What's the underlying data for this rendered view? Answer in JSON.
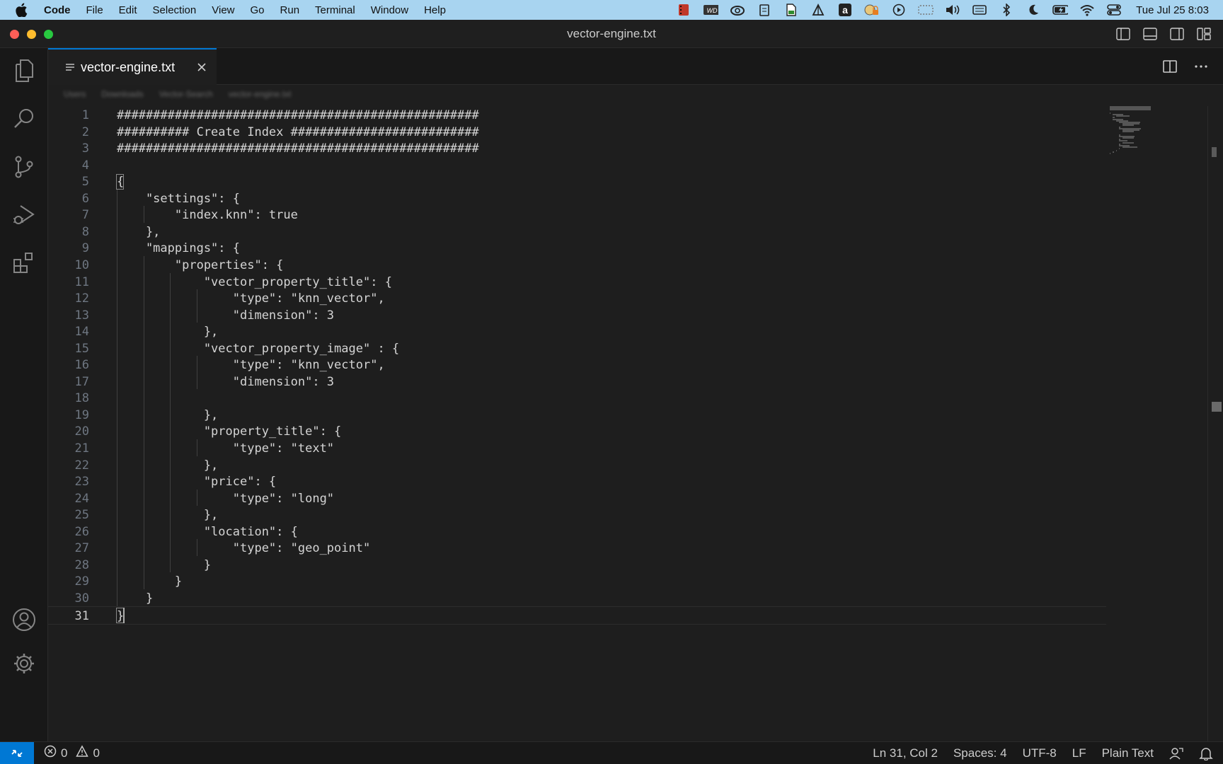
{
  "menubar": {
    "app_name": "Code",
    "items": [
      "File",
      "Edit",
      "Selection",
      "View",
      "Go",
      "Run",
      "Terminal",
      "Window",
      "Help"
    ],
    "status_icons": [
      "screen-recorder-icon",
      "wd-drive-icon",
      "creative-cloud-icon",
      "clipboard-icon",
      "file-icon",
      "vector-app-icon",
      "amazon-icon",
      "vpn-lock-icon",
      "play-icon",
      "display-icon",
      "volume-icon",
      "keyboard-icon",
      "bluetooth-icon",
      "moon-icon",
      "battery-icon",
      "wifi-icon",
      "control-center-icon"
    ],
    "clock": "Tue Jul 25  8:03"
  },
  "window": {
    "title": "vector-engine.txt"
  },
  "tab": {
    "label": "vector-engine.txt"
  },
  "breadcrumb": [
    "Users",
    "Downloads",
    "Vector-Search",
    "vector-engine.txt"
  ],
  "editor": {
    "cursor": {
      "line": 31,
      "col": 2
    },
    "lines": [
      "##################################################",
      "########## Create Index ##########################",
      "##################################################",
      "",
      "{",
      "    \"settings\": {",
      "        \"index.knn\": true",
      "    },",
      "    \"mappings\": {",
      "        \"properties\": {",
      "            \"vector_property_title\": {",
      "                \"type\": \"knn_vector\",",
      "                \"dimension\": 3",
      "            },",
      "            \"vector_property_image\" : {",
      "                \"type\": \"knn_vector\",",
      "                \"dimension\": 3",
      "",
      "            },",
      "            \"property_title\": {",
      "                \"type\": \"text\"",
      "            },",
      "            \"price\": {",
      "                \"type\": \"long\"",
      "            },",
      "            \"location\": {",
      "                \"type\": \"geo_point\"",
      "            }",
      "        }",
      "    }",
      "}"
    ]
  },
  "statusbar": {
    "errors": "0",
    "warnings": "0",
    "position": "Ln 31, Col 2",
    "spaces": "Spaces: 4",
    "encoding": "UTF-8",
    "eol": "LF",
    "language": "Plain Text"
  },
  "colors": {
    "accent": "#0078d4",
    "menubar_bg": "#a8d4f0",
    "editor_bg": "#1e1e1e"
  }
}
